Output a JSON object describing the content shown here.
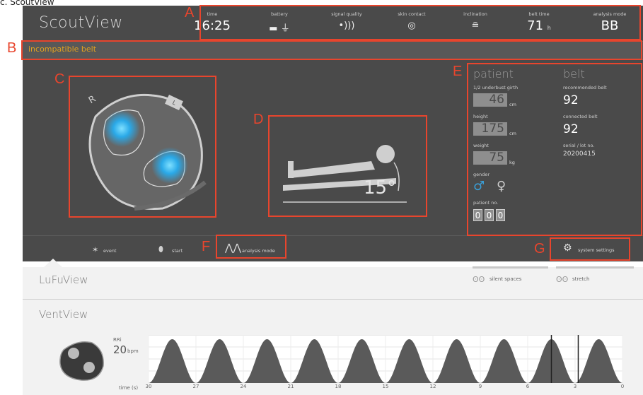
{
  "caption": "c. ScoutView",
  "app_title": "ScoutView",
  "status": {
    "time": {
      "label": "time",
      "value": "16:25"
    },
    "battery": {
      "label": "battery"
    },
    "signal": {
      "label": "signal quality"
    },
    "skin": {
      "label": "skin contact"
    },
    "inclination": {
      "label": "inclination"
    },
    "belt_time": {
      "label": "belt time",
      "value": "71",
      "unit": "h"
    },
    "analysis": {
      "label": "analysis mode",
      "value": "BB"
    }
  },
  "alert": "incompatible belt",
  "labels": {
    "A": "A",
    "B": "B",
    "C": "C",
    "D": "D",
    "E": "E",
    "F": "F",
    "G": "G"
  },
  "thorax": {
    "right_marker": "R",
    "left_marker": "L"
  },
  "inclination_value": "15°",
  "patient": {
    "title": "patient",
    "girth_label": "1/2 underbust girth",
    "girth_value": "46",
    "girth_unit": "cm",
    "height_label": "height",
    "height_value": "175",
    "height_unit": "cm",
    "weight_label": "weight",
    "weight_value": "75",
    "weight_unit": "kg",
    "gender_label": "gender",
    "patient_no_label": "patient no.",
    "patient_no_digits": [
      "0",
      "0",
      "0"
    ]
  },
  "belt": {
    "title": "belt",
    "recommended_label": "recommended belt",
    "recommended_value": "92",
    "connected_label": "connected belt",
    "connected_value": "92",
    "serial_label": "serial / lot no.",
    "serial_value": "20200415"
  },
  "toolbar": {
    "event": "event",
    "start": "start",
    "analysis": "analysis mode",
    "settings": "system settings"
  },
  "lufu": {
    "title": "LuFuView",
    "silent": "silent spaces",
    "stretch": "stretch"
  },
  "vent": {
    "title": "VentView",
    "rr_label": "RRi",
    "rr_value": "20",
    "rr_unit": "bpm",
    "time_label": "time (s)"
  },
  "colors": {
    "accent": "#e8452d",
    "warning": "#e0a020",
    "gender": "#3a9fd8",
    "dark_panel": "#4a4a4a"
  },
  "chart_data": {
    "type": "area",
    "xlabel": "time (s)",
    "x_ticks": [
      30,
      27,
      24,
      21,
      18,
      15,
      12,
      9,
      6,
      3,
      0
    ],
    "xlim": [
      30,
      0
    ],
    "cycles": 10,
    "markers_at": [
      4.5,
      2.8
    ],
    "series": [
      {
        "values": [
          0,
          1,
          0,
          1,
          0,
          1,
          0,
          1,
          0,
          1,
          0,
          1,
          0,
          1,
          0,
          1,
          0,
          1,
          0,
          1,
          0
        ]
      }
    ]
  }
}
